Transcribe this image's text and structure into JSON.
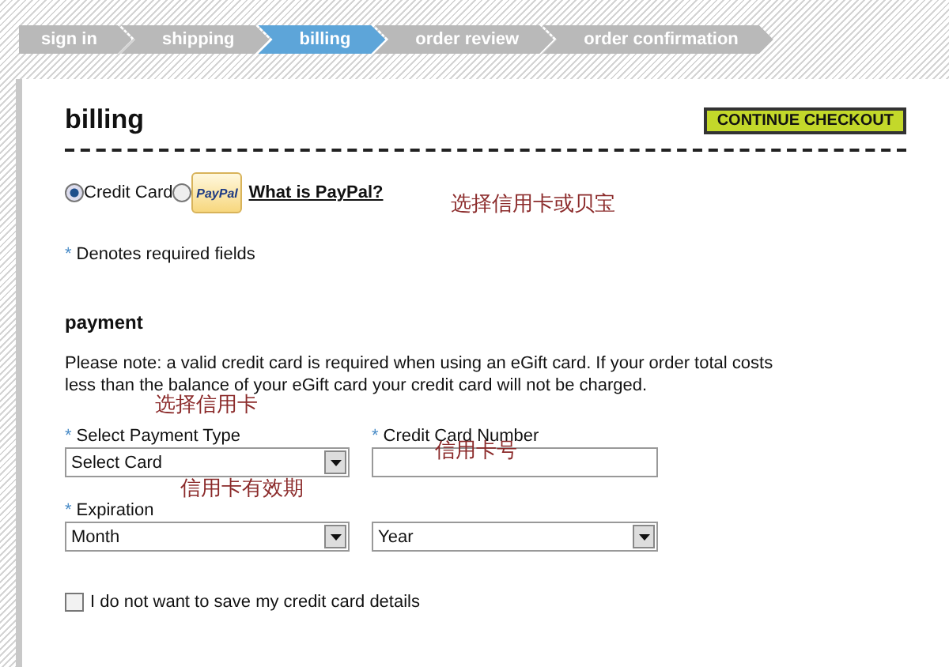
{
  "steps": [
    {
      "label": "sign in",
      "selected": false
    },
    {
      "label": "shipping",
      "selected": false
    },
    {
      "label": "billing",
      "selected": true
    },
    {
      "label": "order review",
      "selected": false
    },
    {
      "label": "order confirmation",
      "selected": false
    }
  ],
  "title": "billing",
  "continue_button": "CONTINUE CHECKOUT",
  "payment_methods": [
    {
      "kind": "text",
      "label": "Credit Card",
      "selected": true
    },
    {
      "kind": "logo",
      "label": "PayPal",
      "selected": false
    }
  ],
  "paypal_link": "What is PayPal?",
  "required_note": {
    "mark": "*",
    "text": "Denotes required fields"
  },
  "section_title": "payment",
  "notice": "Please note: a valid credit card is required when using an eGift card. If your order total costs less than the balance of your eGift card your credit card will not be charged.",
  "fields": {
    "payment_type": {
      "mark": "*",
      "label": "Select Payment Type",
      "value": "Select Card"
    },
    "card_number": {
      "mark": "*",
      "label": "Credit Card Number"
    },
    "expiration": {
      "mark": "*",
      "label": "Expiration",
      "month": "Month",
      "year": "Year"
    }
  },
  "save_details": {
    "label": "I do not want to save my credit card details",
    "checked": false
  },
  "annotations": [
    {
      "text": "选择信用卡或贝宝"
    },
    {
      "text": "选择信用卡"
    },
    {
      "text": "信用卡号"
    },
    {
      "text": "信用卡有效期"
    }
  ]
}
